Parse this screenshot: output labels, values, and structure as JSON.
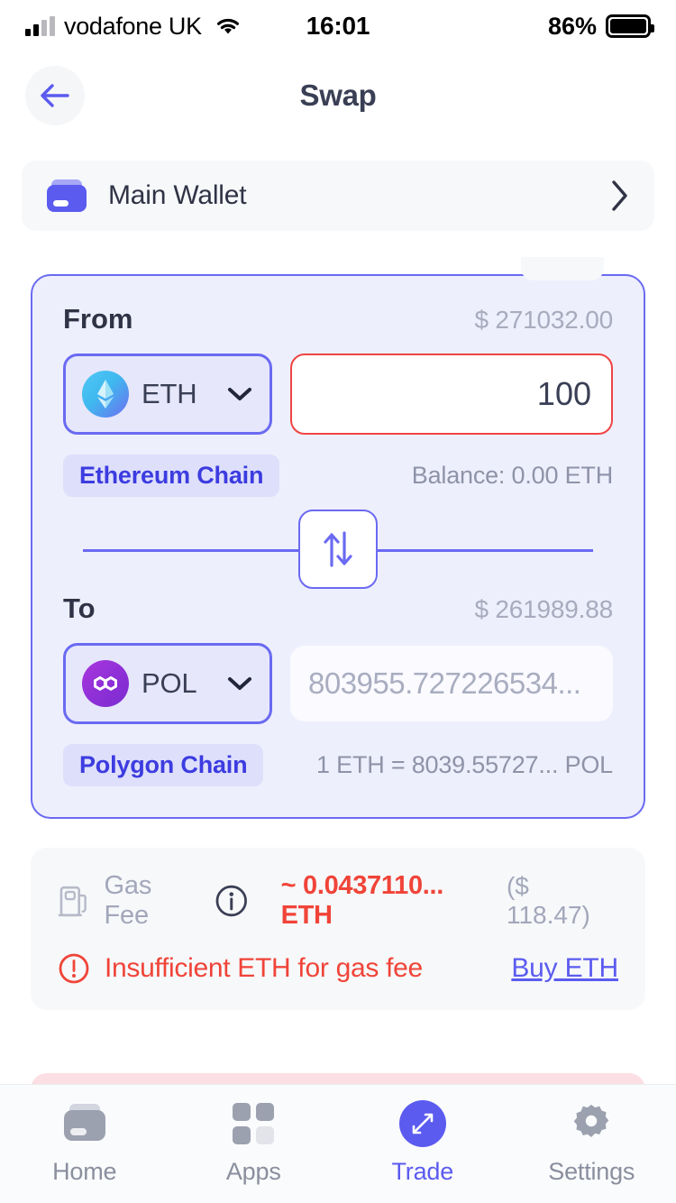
{
  "statusbar": {
    "carrier": "vodafone UK",
    "time": "16:01",
    "battery_pct": "86%",
    "signal_icon": "signal-bars-icon",
    "wifi_icon": "wifi-icon",
    "battery_icon": "battery-icon"
  },
  "header": {
    "title": "Swap",
    "back_icon": "back-arrow-icon"
  },
  "wallet": {
    "name": "Main Wallet",
    "icon": "wallet-icon",
    "chevron_icon": "chevron-right-icon"
  },
  "swap": {
    "from": {
      "label": "From",
      "usd_value": "$ 271032.00",
      "token_symbol": "ETH",
      "token_icon": "eth-token-icon",
      "chevron_icon": "chevron-down-icon",
      "amount": "100",
      "chain": "Ethereum Chain",
      "balance": "Balance: 0.00 ETH"
    },
    "toggle_icon": "swap-direction-icon",
    "to": {
      "label": "To",
      "usd_value": "$ 261989.88",
      "token_symbol": "POL",
      "token_icon": "pol-token-icon",
      "chevron_icon": "chevron-down-icon",
      "amount": "803955.727226534...",
      "chain": "Polygon Chain",
      "rate": "1 ETH = 8039.55727... POL"
    }
  },
  "gas": {
    "pump_icon": "gas-pump-icon",
    "label": "Gas Fee",
    "info_icon": "info-icon",
    "value": "~ 0.0437110... ETH",
    "usd": "($ 118.47)",
    "warning_icon": "alert-circle-icon",
    "warning": "Insufficient ETH for gas fee",
    "buy_link": "Buy ETH"
  },
  "tabbar": {
    "items": [
      {
        "label": "Home",
        "icon": "wallet-nav-icon",
        "active": false
      },
      {
        "label": "Apps",
        "icon": "grid-nav-icon",
        "active": false
      },
      {
        "label": "Trade",
        "icon": "trade-expand-icon",
        "active": true
      },
      {
        "label": "Settings",
        "icon": "gear-nav-icon",
        "active": false
      }
    ]
  },
  "colors": {
    "accent": "#5b5bf0",
    "card_border": "#6a6af2",
    "card_bg": "#eeeffc",
    "danger": "#f04438",
    "muted": "#a2a7ba",
    "disabled_button": "#fbdfe4"
  }
}
